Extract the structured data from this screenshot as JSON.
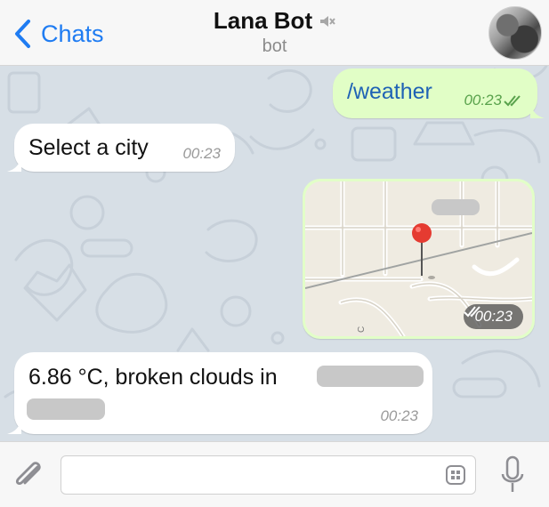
{
  "header": {
    "back_label": "Chats",
    "title": "Lana Bot",
    "subtitle": "bot",
    "icons": {
      "back": "chevron-left-icon",
      "mute": "speaker-muted-icon",
      "avatar": "profile-avatar"
    }
  },
  "messages": [
    {
      "direction": "outgoing",
      "text": "/weather",
      "time": "00:23",
      "status": "read"
    },
    {
      "direction": "incoming",
      "text": "Select a city",
      "time": "00:23"
    },
    {
      "direction": "outgoing",
      "type": "location",
      "time": "00:23",
      "status": "read"
    },
    {
      "direction": "incoming",
      "text": "6.86 °C, broken clouds in",
      "time": "00:23"
    }
  ],
  "input": {
    "placeholder": "",
    "value": ""
  },
  "colors": {
    "accent": "#1f7cf2",
    "chat_background": "#d7dfe6",
    "outgoing_bubble": "#e1fec6",
    "incoming_bubble": "#ffffff",
    "read_check": "#59a24c",
    "map_pin": "#e53b31"
  }
}
